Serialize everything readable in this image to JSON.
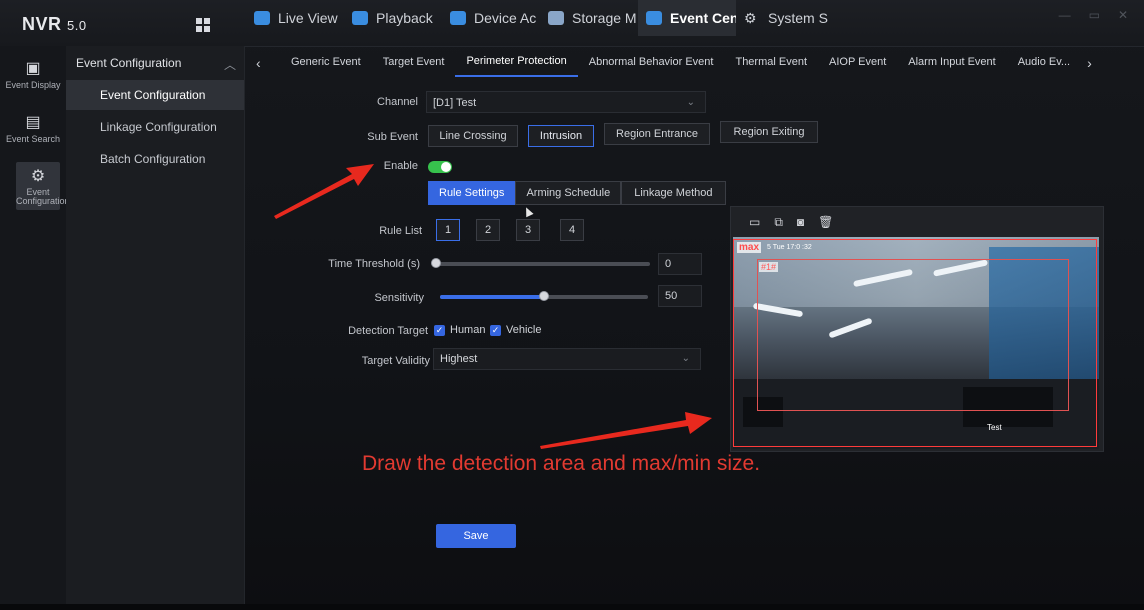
{
  "app": {
    "logo": "NVR",
    "logo_version": "5.0"
  },
  "topnav": [
    {
      "label": "Live View",
      "color": "#3a8de0"
    },
    {
      "label": "Playback",
      "color": "#3a8de0"
    },
    {
      "label": "Device Ac",
      "color": "#3a8de0"
    },
    {
      "label": "Storage M",
      "color": "#8aa6c8"
    },
    {
      "label": "Event Cen",
      "color": "#3a8de0",
      "active": true
    },
    {
      "label": "System S",
      "color": "#cfd2d8"
    }
  ],
  "iconbar": [
    {
      "label": "Event Display",
      "icon": "display-icon"
    },
    {
      "label": "Event Search",
      "icon": "search-doc-icon"
    },
    {
      "label": "Event Configuration",
      "icon": "gear-icon",
      "active": true
    }
  ],
  "menu": {
    "header": "Event Configuration",
    "items": [
      "Event Configuration",
      "Linkage Configuration",
      "Batch Configuration"
    ],
    "active_index": 0
  },
  "subtabs": {
    "items": [
      "Generic Event",
      "Target Event",
      "Perimeter Protection",
      "Abnormal Behavior Event",
      "Thermal Event",
      "AIOP Event",
      "Alarm Input Event",
      "Audio Ev..."
    ],
    "active_index": 2
  },
  "form": {
    "channel_label": "Channel",
    "channel_value": "[D1] Test",
    "sub_event_label": "Sub Event",
    "sub_events": [
      "Line Crossing",
      "Intrusion",
      "Region Entrance",
      "Region Exiting"
    ],
    "sub_event_active": 1,
    "enable_label": "Enable",
    "enable_on": true,
    "settings_tabs": [
      "Rule Settings",
      "Arming Schedule",
      "Linkage Method"
    ],
    "settings_active": 0,
    "rule_list_label": "Rule List",
    "rules": [
      "1",
      "2",
      "3",
      "4"
    ],
    "rule_active": 0,
    "time_threshold_label": "Time Threshold (s)",
    "time_threshold_value": "0",
    "time_threshold_fraction": 0.0,
    "sensitivity_label": "Sensitivity",
    "sensitivity_value": "50",
    "sensitivity_fraction": 0.5,
    "detection_target_label": "Detection Target",
    "human_label": "Human",
    "vehicle_label": "Vehicle",
    "human_checked": true,
    "vehicle_checked": true,
    "target_validity_label": "Target Validity",
    "target_validity_value": "Highest",
    "save_label": "Save"
  },
  "video": {
    "max_label": "max",
    "osd_text": "5 Tue 17:0 :32",
    "rule_tag": "#1#",
    "camera_name": "Test"
  },
  "annotation": {
    "instruction": "Draw the detection area and max/min size.",
    "arrow_color": "#e8291e"
  }
}
